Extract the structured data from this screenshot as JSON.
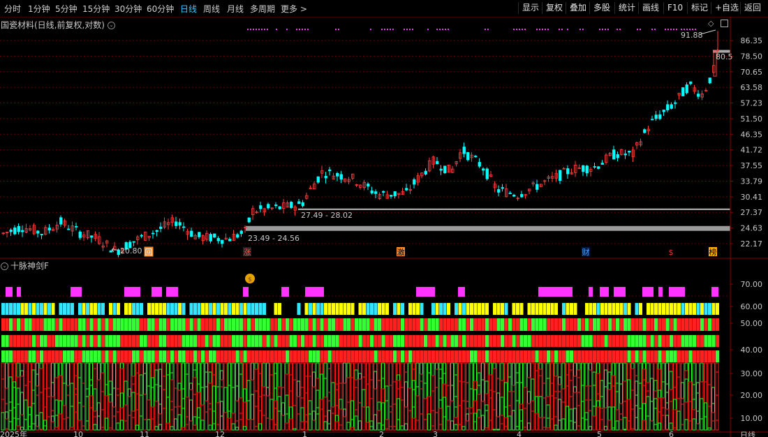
{
  "toolbar": {
    "periods": [
      "分时",
      "1分钟",
      "5分钟",
      "15分钟",
      "30分钟",
      "60分钟",
      "日线",
      "周线",
      "月线",
      "多周期",
      "更多"
    ],
    "active_period": "日线",
    "more_arrow": ">",
    "right_buttons": [
      "显示",
      "复权",
      "叠加",
      "多股",
      "统计",
      "画线",
      "F10",
      "标记",
      "+自选",
      "返回"
    ]
  },
  "main_panel": {
    "title": "国瓷材料(日线,前复权,对数)",
    "y_labels": [
      "86.35",
      "78.50",
      "70.65",
      "63.58",
      "57.23",
      "51.50",
      "46.35",
      "41.72",
      "37.55",
      "33.79",
      "30.41",
      "27.37",
      "24.63",
      "22.17"
    ],
    "annotations": {
      "high": "91.88",
      "current": "80.5",
      "low": "20.80",
      "band_upper": "27.49 - 28.02",
      "band_lower": "23.49 - 24.56"
    },
    "event_markers": [
      "回",
      "涨",
      "激",
      "财",
      "$",
      "榜"
    ]
  },
  "indicator_panel": {
    "title": "十脉神剑F",
    "y_labels": [
      "70.00",
      "60.00",
      "50.00",
      "40.00",
      "30.00",
      "20.00",
      "10.00"
    ],
    "money_icon": "money-bag"
  },
  "bottom_axis": {
    "partial_labels": [
      "2025年",
      "10",
      "11",
      "12",
      "1",
      "2",
      "3",
      "4",
      "5",
      "6"
    ],
    "period_label": "日线"
  },
  "colors": {
    "up": "#ff3c3c",
    "down": "#00ffff",
    "magenta": "#ff33ff",
    "yellow": "#ffff00",
    "green": "#33ff33",
    "red": "#ff2020",
    "grid": "#6a0000",
    "band": "#9a9a9a",
    "active_tab": "#39c8ff"
  }
}
